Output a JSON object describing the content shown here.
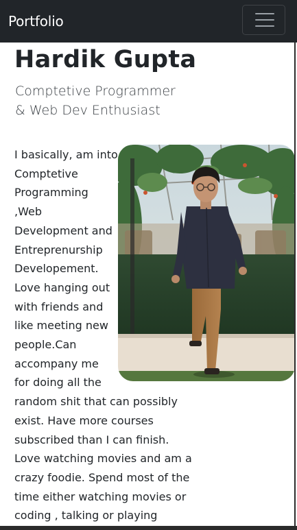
{
  "navbar": {
    "brand": "Portfolio",
    "toggler_icon": "hamburger-menu-icon"
  },
  "hero": {
    "name": "Hardik Gupta",
    "tagline_lines": [
      "Comptetive Programmer",
      "& Web Dev Enthusiast"
    ]
  },
  "profile_photo": {
    "subject": "profile-photo"
  },
  "bio": {
    "lines": [
      "I basically, am into",
      "Comptetive",
      "Programming",
      ",Web",
      "Development and",
      "Entreprenurship",
      "Developement.",
      "Love hanging out",
      "with friends and",
      "like meeting new",
      "people.Can",
      "accompany me",
      "for doing all the",
      "random shit that can possibly",
      "exist. Have more courses",
      "subscribed than I can finish.",
      "Love watching movies and am a",
      "crazy foodie. Spend most of the",
      "time either watching movies or",
      "coding , talking or playing"
    ]
  },
  "colors": {
    "navbar_bg": "#212529",
    "text": "#212529"
  }
}
